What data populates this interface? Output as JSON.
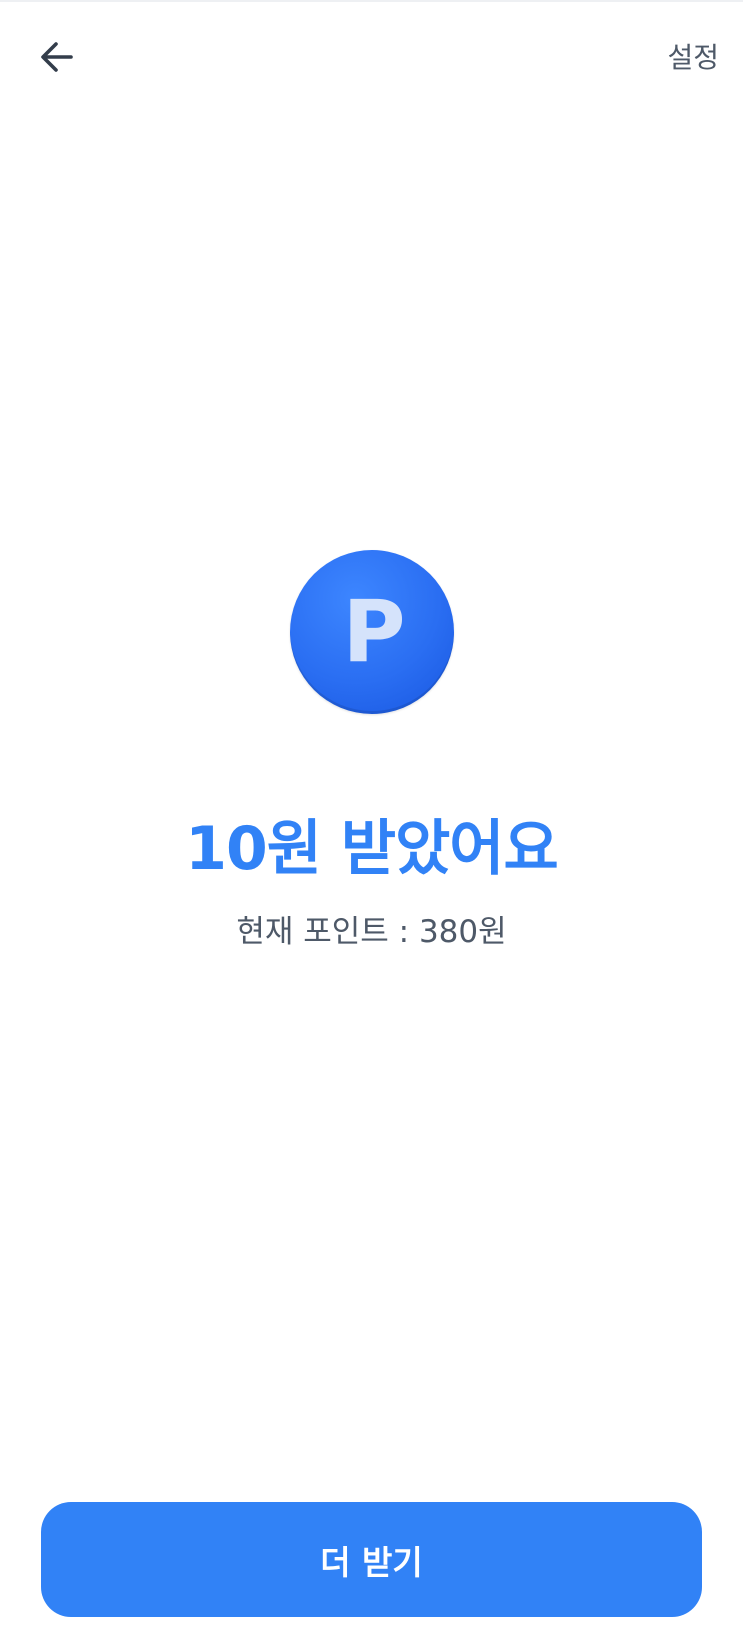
{
  "header": {
    "back_icon": "arrow-left-icon",
    "settings_label": "설정"
  },
  "reward": {
    "coin_icon": "point-coin-icon",
    "coin_letter": "P",
    "headline": "10원 받았어요",
    "current_points": "현재 포인트 : 380원"
  },
  "footer": {
    "more_button_label": "더 받기"
  },
  "colors": {
    "accent": "#3182f6",
    "coin": "#2a6ef2",
    "text_secondary": "#4e5968",
    "background": "#ffffff"
  }
}
